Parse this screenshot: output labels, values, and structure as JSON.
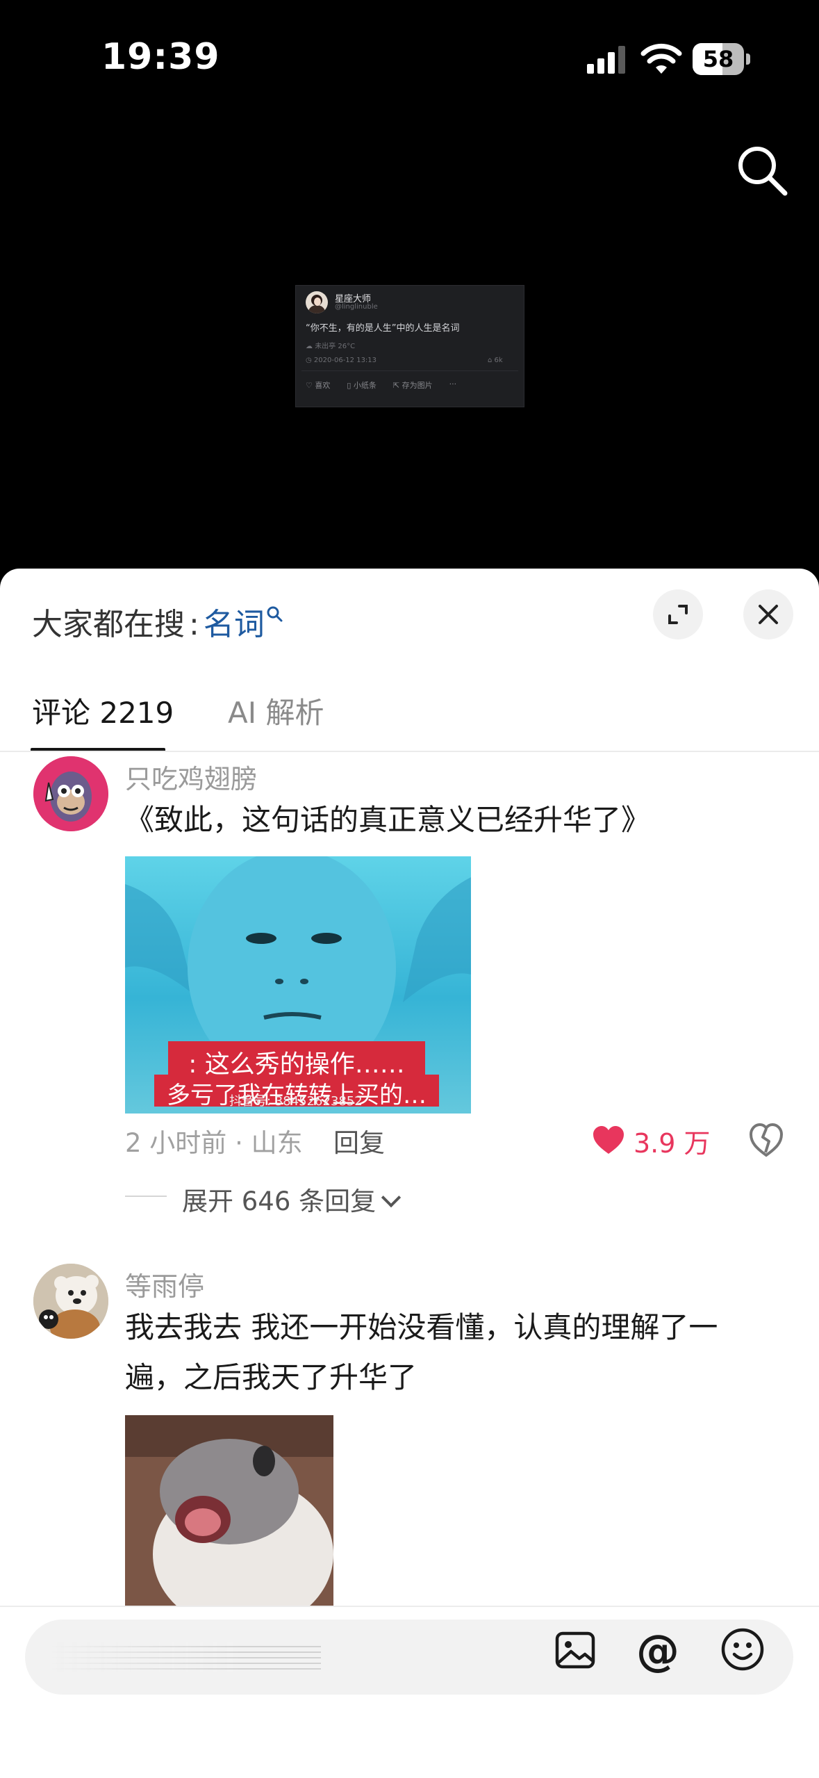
{
  "status_bar": {
    "time": "19:39",
    "battery": 58
  },
  "video_card": {
    "author": "星座大师",
    "handle": "@linglinuble",
    "quote": "“你不生，有的是人生”中的人生是名词",
    "weather": "未出亭 26°C",
    "date": "2020-06-12 13:13",
    "count": "6k",
    "actions": [
      "喜欢",
      "小纸条",
      "存为图片"
    ]
  },
  "sheet": {
    "trending_label": "大家都在搜",
    "trending_separator": ":",
    "trending_keyword": "名词",
    "tabs": [
      {
        "label": "评论 2219",
        "active": true
      },
      {
        "label": "AI 解析",
        "active": false
      }
    ]
  },
  "comments": [
    {
      "name": "只吃鸡翅膀",
      "text": "《致此，这句话的真正意义已经升华了》",
      "image_caption_1": ": 这么秀的操作……",
      "image_caption_2": "多亏了我在转转上买的…",
      "image_watermark": "抖音号: 38452623852",
      "meta": "2 小时前 · 山东",
      "reply_label": "回复",
      "likes": "3.9 万",
      "expand_replies": "展开 646 条回复"
    },
    {
      "name": "等雨停",
      "text": "我去我去 我还一开始没看懂，认真的理解了一遍，之后我天了升华了"
    }
  ],
  "colors": {
    "like": "#e8365d",
    "keyword": "#1e5aa0"
  },
  "icons": [
    "search-icon",
    "expand-icon",
    "close-icon",
    "heart-icon",
    "dislike-icon",
    "chevron-down-icon",
    "image-icon",
    "at-icon",
    "emoji-icon"
  ]
}
